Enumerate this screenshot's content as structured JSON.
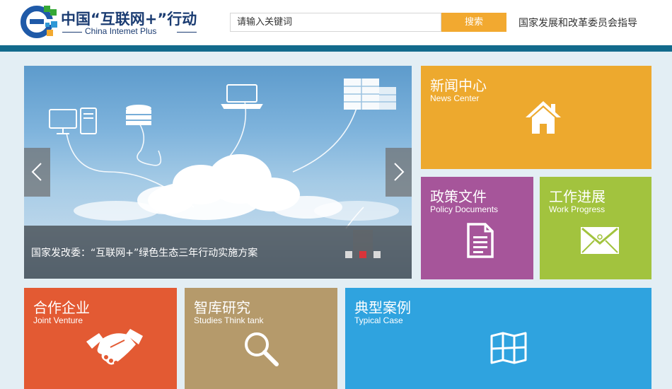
{
  "logo": {
    "cn_text": "中国“互联网+”行动",
    "en_text": "China Intemet Plus"
  },
  "search": {
    "placeholder": "请输入关键词",
    "button_label": "搜索"
  },
  "header": {
    "guide_text": "国家发展和改革委员会指导"
  },
  "carousel": {
    "caption": "国家发改委：“互联网+”绿色生态三年行动实施方案",
    "dots": 3,
    "active_dot": 2
  },
  "tiles": {
    "news": {
      "cn": "新闻中心",
      "en": "News Center",
      "icon": "home-icon",
      "color": "#eda92e"
    },
    "policy": {
      "cn": "政策文件",
      "en": "Policy Documents",
      "icon": "document-icon",
      "color": "#a6559a"
    },
    "progress": {
      "cn": "工作进展",
      "en": "Work Progress",
      "icon": "envelope-icon",
      "color": "#a2c33e"
    },
    "joint": {
      "cn": "合作企业",
      "en": "Joint Venture",
      "icon": "handshake-icon",
      "color": "#e35a33"
    },
    "think": {
      "cn": "智库研究",
      "en": "Studies Think tank",
      "icon": "magnifier-icon",
      "color": "#b59a6b"
    },
    "cases": {
      "cn": "典型案例",
      "en": "Typical Case",
      "icon": "map-icon",
      "color": "#2fa3df"
    }
  }
}
